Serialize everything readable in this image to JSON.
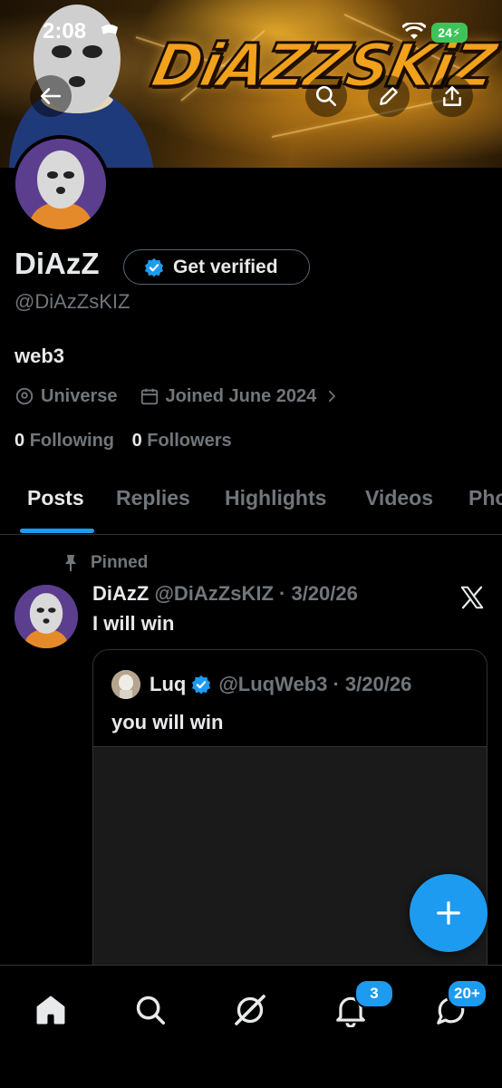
{
  "status_bar": {
    "time": "2:08",
    "battery": "24"
  },
  "banner": {
    "brand_text": "DiAZZSKiZ"
  },
  "profile": {
    "display_name": "DiAzZ",
    "get_verified_label": "Get verified",
    "handle": "@DiAzZsKIZ",
    "bio": "web3",
    "location": "Universe",
    "joined": "Joined June 2024",
    "following_count": "0",
    "following_label": "Following",
    "followers_count": "0",
    "followers_label": "Followers"
  },
  "tabs": [
    {
      "label": "Posts",
      "active": true
    },
    {
      "label": "Replies"
    },
    {
      "label": "Highlights"
    },
    {
      "label": "Videos"
    },
    {
      "label": "Photos"
    }
  ],
  "pinned_post": {
    "pinned_label": "Pinned",
    "author_name": "DiAzZ",
    "author_handle_date": "@DiAzZsKIZ · 3/20/26",
    "text": "I will win",
    "quote": {
      "author_name": "Luq",
      "author_handle_date": "@LuqWeb3 · 3/20/26",
      "text": "you will win"
    }
  },
  "bottom_nav": {
    "items": [
      "home-icon",
      "search-icon",
      "grok-icon",
      "notifications-icon",
      "messages-icon"
    ],
    "notifications_badge": "3",
    "messages_badge": "20+"
  },
  "colors": {
    "accent": "#1d9bf0",
    "text": "#e7e9ea",
    "muted": "#71767b",
    "background": "#000000"
  }
}
